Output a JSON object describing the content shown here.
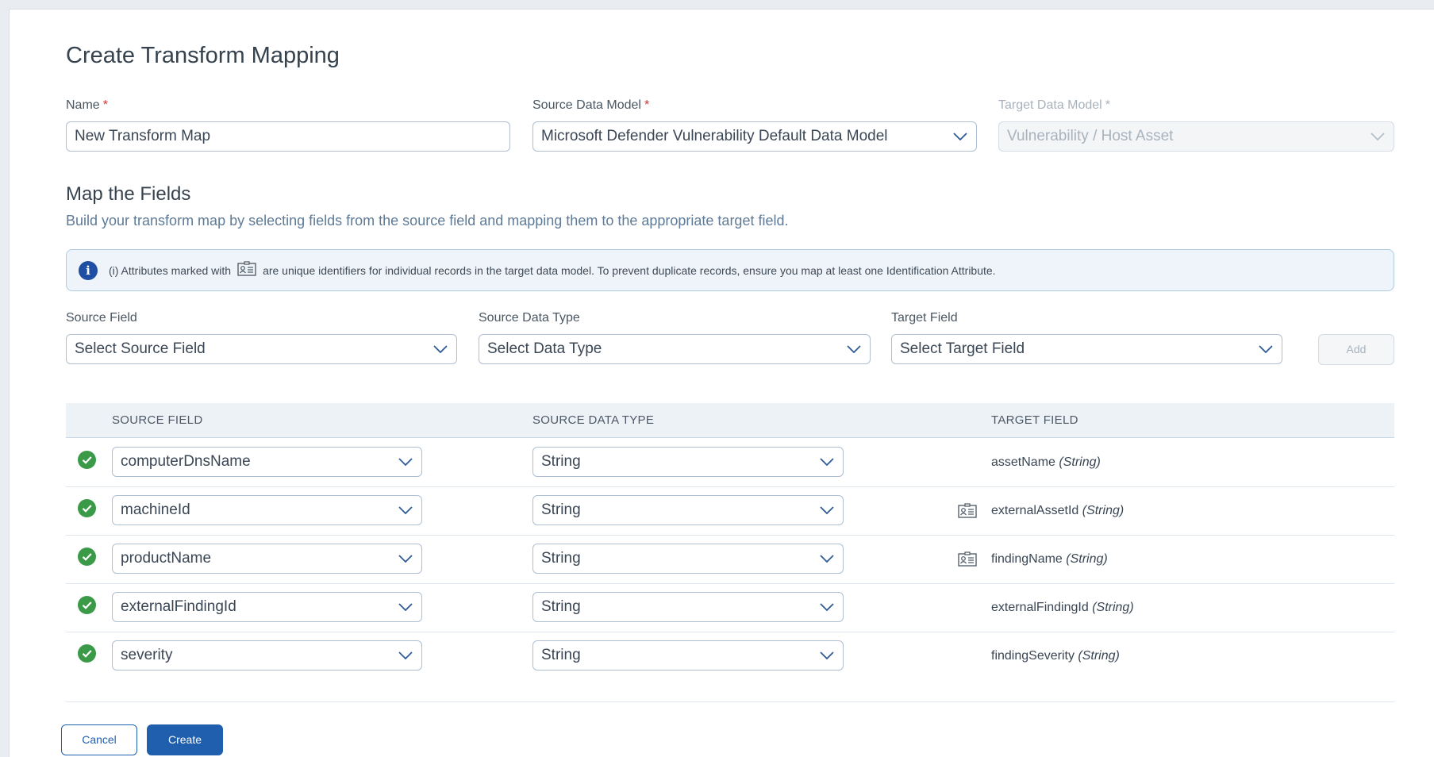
{
  "page": {
    "title": "Create Transform Mapping"
  },
  "form": {
    "name_label": "Name",
    "name_value": "New Transform Map",
    "source_model_label": "Source Data Model",
    "source_model_value": "Microsoft Defender Vulnerability Default Data Model",
    "target_model_label": "Target Data Model",
    "target_model_value": "Vulnerability / Host Asset",
    "required_mark": "*"
  },
  "map_section": {
    "title": "Map the Fields",
    "subtitle": "Build your transform map by selecting fields from the source field and mapping them to the appropriate target field."
  },
  "info": {
    "text_before": "(i) Attributes marked with",
    "text_after": "are unique identifiers for individual records in the target data model. To prevent duplicate records, ensure you map at least one Identification Attribute."
  },
  "selector": {
    "source_field_label": "Source Field",
    "source_field_placeholder": "Select Source Field",
    "source_type_label": "Source Data Type",
    "source_type_placeholder": "Select Data Type",
    "target_field_label": "Target Field",
    "target_field_placeholder": "Select Target Field",
    "add_label": "Add"
  },
  "table": {
    "headers": {
      "source_field": "SOURCE FIELD",
      "source_type": "SOURCE DATA TYPE",
      "target_field": "TARGET FIELD"
    },
    "rows": [
      {
        "source": "computerDnsName",
        "type": "String",
        "target": "assetName",
        "target_type": "(String)",
        "identifier": false
      },
      {
        "source": "machineId",
        "type": "String",
        "target": "externalAssetId",
        "target_type": "(String)",
        "identifier": true
      },
      {
        "source": "productName",
        "type": "String",
        "target": "findingName",
        "target_type": "(String)",
        "identifier": true
      },
      {
        "source": "externalFindingId",
        "type": "String",
        "target": "externalFindingId",
        "target_type": "(String)",
        "identifier": false
      },
      {
        "source": "severity",
        "type": "String",
        "target": "findingSeverity",
        "target_type": "(String)",
        "identifier": false
      }
    ]
  },
  "footer": {
    "cancel_label": "Cancel",
    "create_label": "Create"
  },
  "colors": {
    "primary": "#1f5fae",
    "success": "#3b9a48",
    "required": "#d3312f",
    "info_bg": "#eef4fa"
  },
  "icons": {
    "row_status": "check-circle-icon",
    "identifier": "id-card-icon",
    "info": "info-icon",
    "dropdown": "chevron-down-icon"
  }
}
